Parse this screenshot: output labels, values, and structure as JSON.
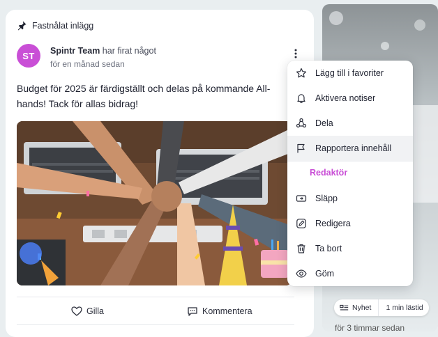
{
  "post": {
    "pinned_label": "Fastnålat inlägg",
    "avatar_initials": "ST",
    "author": "Spintr Team",
    "action": "har firat något",
    "time": "för en månad sedan",
    "body": "Budget för 2025 är färdigställt och delas på kommande All-hands! Tack för allas bidrag!",
    "like_label": "Gilla",
    "comment_label": "Kommentera"
  },
  "menu": {
    "items": [
      {
        "label": "Lägg till i favoriter",
        "icon": "star-icon"
      },
      {
        "label": "Aktivera notiser",
        "icon": "bell-icon"
      },
      {
        "label": "Dela",
        "icon": "share-icon"
      },
      {
        "label": "Rapportera innehåll",
        "icon": "flag-icon"
      }
    ],
    "section_label": "Redaktör",
    "editor_items": [
      {
        "label": "Släpp",
        "icon": "release-icon"
      },
      {
        "label": "Redigera",
        "icon": "edit-icon"
      },
      {
        "label": "Ta bort",
        "icon": "trash-icon"
      },
      {
        "label": "Göm",
        "icon": "eye-icon"
      }
    ]
  },
  "sidebar_card": {
    "badge_type": "Nyhet",
    "read_time": "1 min lästid",
    "bottom_text": "för 3 timmar sedan"
  },
  "colors": {
    "accent": "#c94fd6",
    "background": "#e9eef0"
  }
}
